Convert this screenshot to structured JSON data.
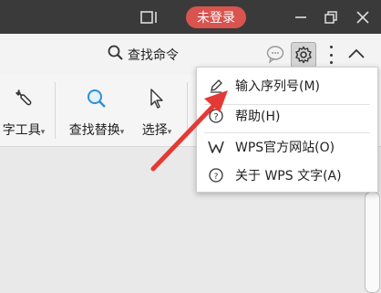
{
  "titlebar": {
    "login_label": "未登录"
  },
  "toolbar": {
    "search_command_label": "查找命令"
  },
  "ribbon": {
    "tools_label": "字工具",
    "find_replace_label": "查找替换",
    "select_label": "选择"
  },
  "menu": {
    "items": [
      {
        "label": "输入序列号(M)",
        "icon": "pencil-icon"
      },
      {
        "label": "帮助(H)",
        "icon": "help-icon"
      },
      {
        "label": "WPS官方网站(O)",
        "icon": "wps-logo-icon"
      },
      {
        "label": "关于 WPS 文字(A)",
        "icon": "about-icon"
      }
    ]
  },
  "colors": {
    "titlebar_bg": "#3a3a3a",
    "login_bg": "#d9534f",
    "annotation_arrow": "#e53935"
  }
}
